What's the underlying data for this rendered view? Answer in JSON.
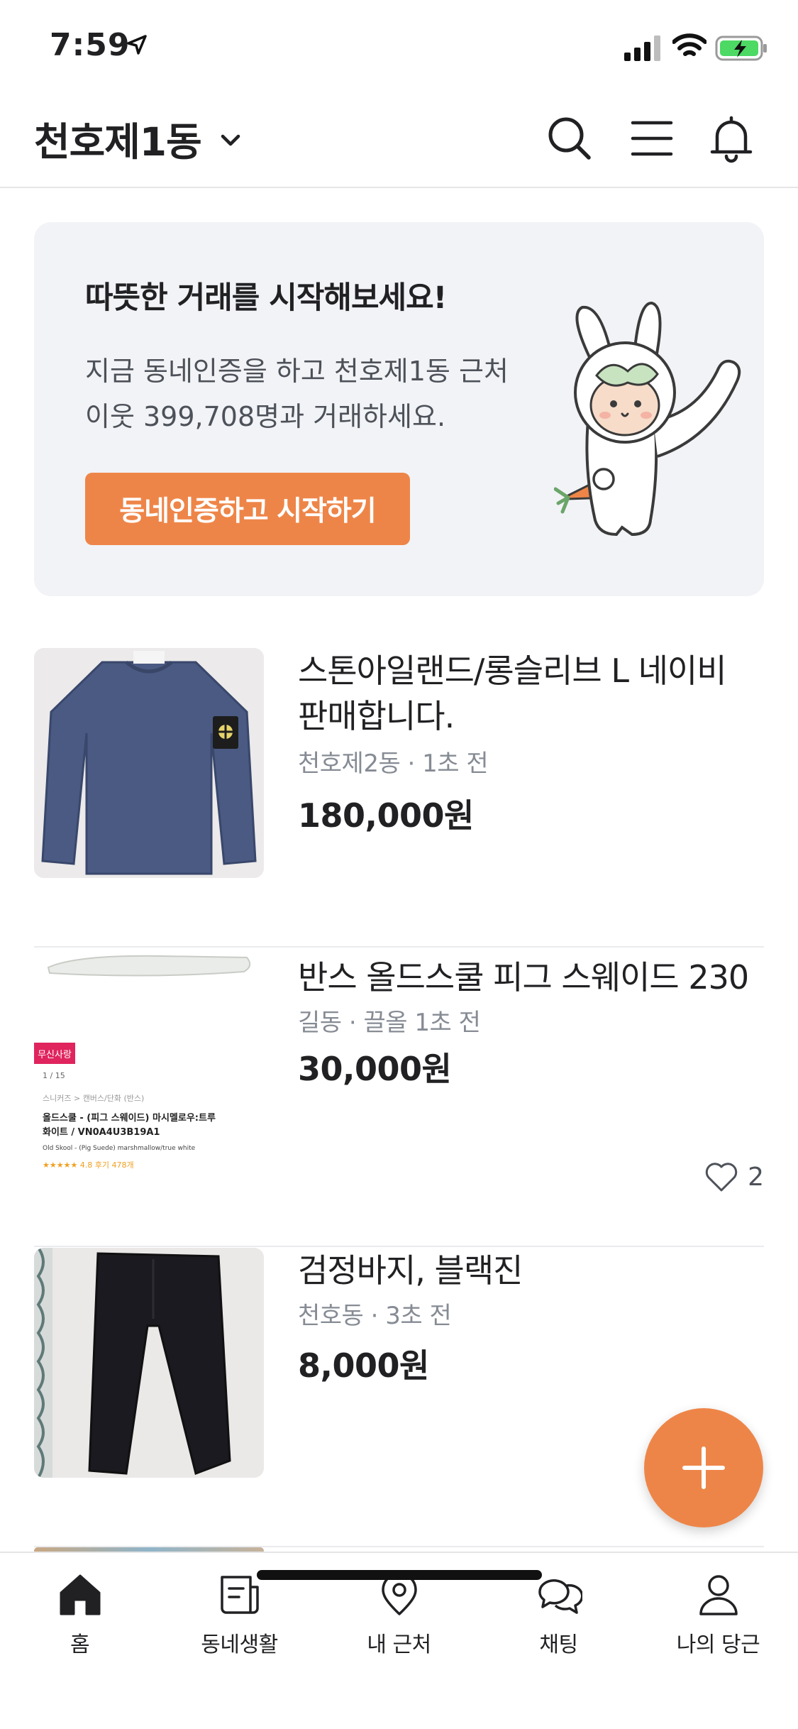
{
  "status_bar": {
    "time": "7:59"
  },
  "header": {
    "location": "천호제1동",
    "icons": [
      "search-icon",
      "menu-icon",
      "bell-icon"
    ]
  },
  "banner": {
    "title": "따뜻한 거래를 시작해보세요!",
    "description": "지금 동네인증을 하고 천호제1동 근처 이웃 399,708명과 거래하세요.",
    "button_label": "동네인증하고 시작하기"
  },
  "listings": [
    {
      "title": "스톤아일랜드/롱슬리브 L 네이비 판매합니다.",
      "meta": "천호제2동 · 1초 전",
      "price": "180,000원"
    },
    {
      "title": "반스 올드스쿨 피그 스웨이드 230",
      "meta": "길동 · 끌올 1초 전",
      "price": "30,000원",
      "likes": "2",
      "thumb_text": {
        "badge": "무신사랑",
        "page": "1 / 15",
        "breadcrumb": "스니커즈 > 캔버스/단화 (반스)",
        "name_line1": "올드스쿨 - (피그 스웨이드) 마시멜로우:트루",
        "name_line2": "화이트 / VN0A4U3B19A1",
        "sub": "Old Skool - (Pig Suede) marshmallow/true white",
        "rating": "★★★★★ 4.8  후기 478개"
      }
    },
    {
      "title": "검정바지, 블랙진",
      "meta": "천호동 · 3초 전",
      "price": "8,000원"
    }
  ],
  "tabs": [
    {
      "label": "홈",
      "icon": "home-icon"
    },
    {
      "label": "동네생활",
      "icon": "newspaper-icon"
    },
    {
      "label": "내 근처",
      "icon": "location-pin-icon"
    },
    {
      "label": "채팅",
      "icon": "chat-icon"
    },
    {
      "label": "나의 당근",
      "icon": "person-icon"
    }
  ],
  "colors": {
    "accent": "#ee8548",
    "banner_bg": "#f2f3f6",
    "meta_text": "#868b94"
  }
}
